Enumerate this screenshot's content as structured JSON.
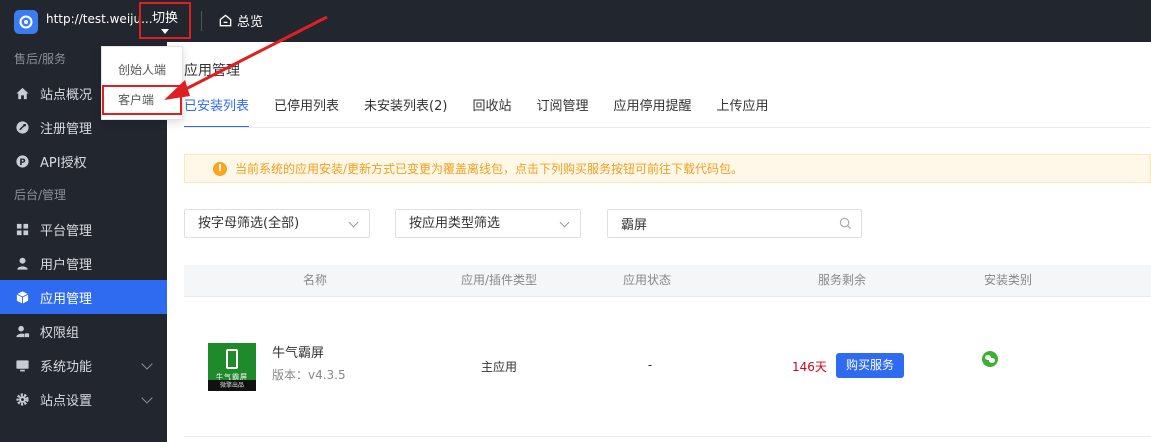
{
  "topbar": {
    "site_url": "http://test.weiju...",
    "switch_label": "切换",
    "overview_label": "总览"
  },
  "dropdown": {
    "items": [
      "创始人端",
      "客户端"
    ]
  },
  "sidebar": {
    "groups": [
      "售后/服务",
      "后台/管理"
    ],
    "items": [
      {
        "label": "站点概况",
        "icon": "home-icon"
      },
      {
        "label": "注册管理",
        "icon": "register-icon"
      },
      {
        "label": "API授权",
        "icon": "api-icon"
      },
      {
        "label": "平台管理",
        "icon": "grid-icon"
      },
      {
        "label": "用户管理",
        "icon": "user-icon"
      },
      {
        "label": "应用管理",
        "icon": "cube-icon"
      },
      {
        "label": "权限组",
        "icon": "user-lock-icon"
      },
      {
        "label": "系统功能",
        "icon": "monitor-icon"
      },
      {
        "label": "站点设置",
        "icon": "gear-icon"
      }
    ],
    "active_color": "#2f6bf0"
  },
  "main": {
    "title": "应用管理",
    "tabs": [
      "已安装列表",
      "已停用列表",
      "未安装列表(2)",
      "回收站",
      "订阅管理",
      "应用停用提醒",
      "上传应用"
    ],
    "notice": "当前系统的应用安装/更新方式已变更为覆盖离线包，点击下列购买服务按钮可前往下载代码包。",
    "filters": {
      "letter_filter": "按字母筛选(全部)",
      "type_filter": "按应用类型筛选",
      "search_value": "霸屏"
    },
    "table": {
      "headers": [
        "名称",
        "应用/插件类型",
        "应用状态",
        "服务剩余",
        "安装类别"
      ],
      "rows": [
        {
          "icon_caption": "牛气霸屏",
          "icon_subcaption": "微擎出品",
          "name": "牛气霸屏",
          "version": "版本：v4.3.5",
          "type": "主应用",
          "status": "-",
          "remain": "146天",
          "buy_label": "购买服务",
          "install_icon": "wechat-icon"
        }
      ]
    }
  }
}
